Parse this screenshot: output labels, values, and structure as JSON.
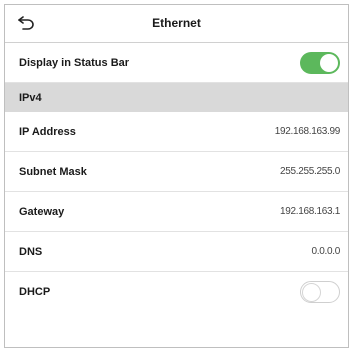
{
  "header": {
    "title": "Ethernet",
    "back_icon": "back-arrow-icon"
  },
  "display_status_bar": {
    "label": "Display in Status Bar",
    "enabled": true
  },
  "section": {
    "label": "IPv4"
  },
  "fields": [
    {
      "label": "IP Address",
      "value": "192.168.163.99"
    },
    {
      "label": "Subnet Mask",
      "value": "255.255.255.0"
    },
    {
      "label": "Gateway",
      "value": "192.168.163.1"
    },
    {
      "label": "DNS",
      "value": "0.0.0.0"
    }
  ],
  "dhcp": {
    "label": "DHCP",
    "enabled": false
  },
  "colors": {
    "toggle_on": "#5cb85c",
    "section_bg": "#d9d9d9"
  }
}
